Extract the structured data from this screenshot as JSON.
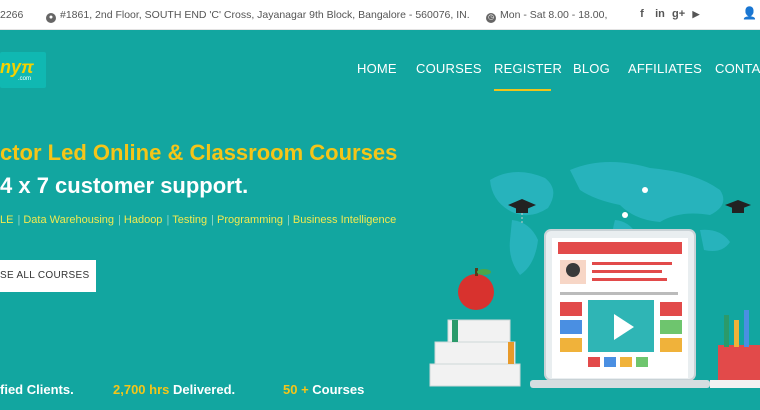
{
  "topbar": {
    "phone": "2266",
    "address": "#1861, 2nd Floor, SOUTH END 'C' Cross, Jayanagar 9th Block, Bangalore - 560076, IN.",
    "hours": "Mon - Sat 8.00 - 18.00,",
    "social": [
      "f",
      "in",
      "g+",
      "yt"
    ]
  },
  "logo": {
    "text": "nyπ",
    "sub": ".com"
  },
  "nav": {
    "home": "HOME",
    "courses": "COURSES",
    "register": "REGISTER",
    "blog": "BLOG",
    "affiliates": "AFFILIATES",
    "contact": "CONTAC"
  },
  "hero": {
    "title_line1": "ctor Led Online & Classroom Courses",
    "title_line2": "4 x 7 customer support.",
    "tags": [
      "LE",
      "Data Warehousing",
      "Hadoop",
      "Testing",
      "Programming",
      "Business Intelligence"
    ],
    "button": "SE ALL COURSES"
  },
  "stats": [
    {
      "value": "",
      "label": "fied Clients."
    },
    {
      "value": "2,700 hrs",
      "label": " Delivered."
    },
    {
      "value": "50 +",
      "label": " Courses"
    }
  ],
  "colors": {
    "background": "#12a6a0",
    "accent": "#f5c518",
    "tag": "#f2ea50"
  }
}
